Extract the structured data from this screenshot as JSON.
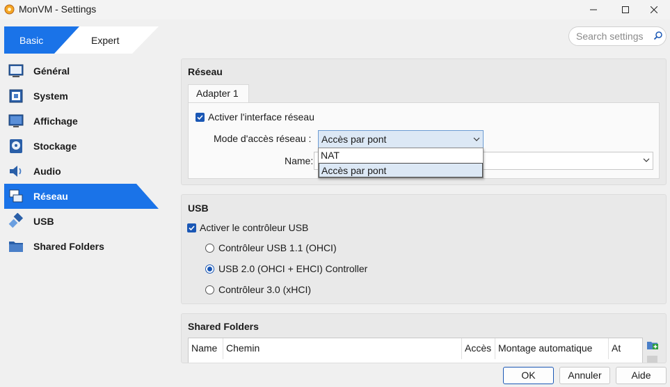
{
  "window": {
    "title": "MonVM - Settings",
    "controls": {
      "minimize": "—",
      "maximize": "☐",
      "close": "✕"
    }
  },
  "mode": {
    "basic_label": "Basic",
    "expert_label": "Expert",
    "selected": "Basic"
  },
  "search": {
    "placeholder": "Search settings",
    "value": ""
  },
  "sidebar": {
    "items": [
      {
        "label": "Général",
        "icon": "general-icon"
      },
      {
        "label": "System",
        "icon": "system-icon"
      },
      {
        "label": "Affichage",
        "icon": "display-icon"
      },
      {
        "label": "Stockage",
        "icon": "storage-icon"
      },
      {
        "label": "Audio",
        "icon": "audio-icon"
      },
      {
        "label": "Réseau",
        "icon": "network-icon",
        "active": true
      },
      {
        "label": "USB",
        "icon": "usb-icon"
      },
      {
        "label": "Shared Folders",
        "icon": "folder-icon"
      }
    ]
  },
  "network": {
    "title": "Réseau",
    "tab_label": "Adapter 1",
    "enable_label": "Activer l'interface réseau",
    "enable_checked": true,
    "access_mode_label": "Mode d'accès réseau :",
    "access_mode_value": "Accès par pont",
    "access_mode_options": [
      "NAT",
      "Accès par pont"
    ],
    "name_label": "Name:"
  },
  "usb": {
    "title": "USB",
    "enable_label": "Activer le contrôleur USB",
    "enable_checked": true,
    "options": [
      {
        "label": "Contrôleur USB 1.1 (OHCI)",
        "selected": false
      },
      {
        "label": "USB 2.0 (OHCI + EHCI) Controller",
        "selected": true
      },
      {
        "label": "Contrôleur 3.0 (xHCI)",
        "selected": false
      }
    ]
  },
  "shared_folders": {
    "title": "Shared Folders",
    "columns": [
      "Name",
      "Chemin",
      "Accès",
      "Montage automatique",
      "At"
    ]
  },
  "buttons": {
    "ok": "OK",
    "cancel": "Annuler",
    "help": "Aide"
  },
  "colors": {
    "accent": "#1a73e8",
    "checkbox": "#1a57b5",
    "dropdown_selected": "#dce8f5"
  }
}
